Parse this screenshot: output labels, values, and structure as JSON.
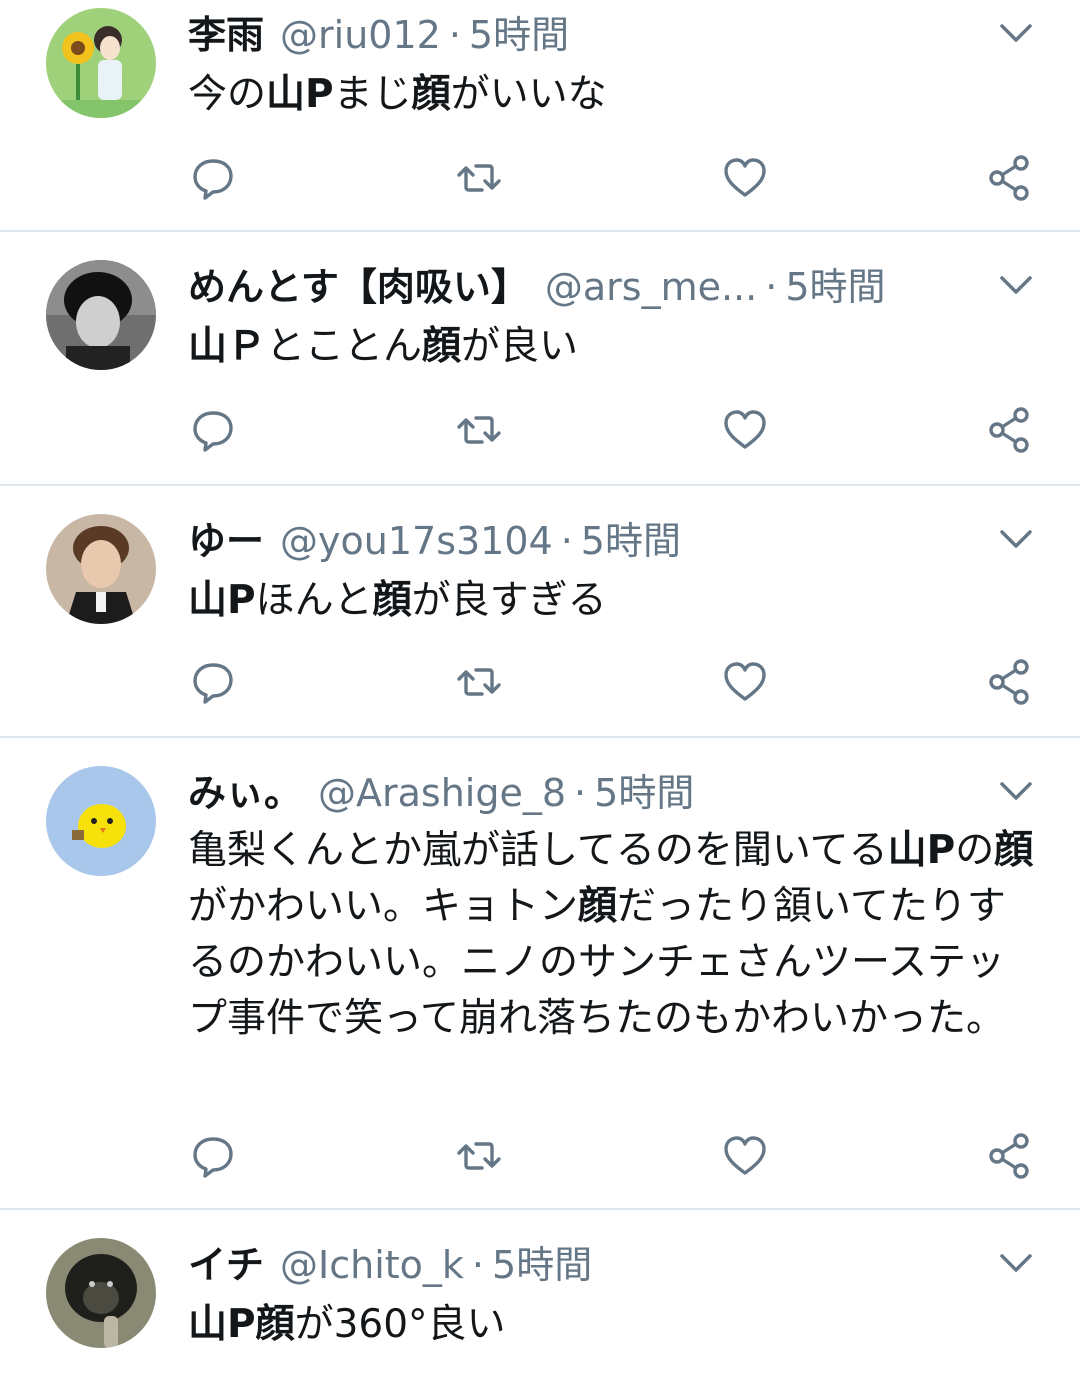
{
  "colors": {
    "text": "#14171a",
    "muted": "#657786",
    "divider": "#e1e8ed",
    "background": "#ffffff"
  },
  "action_icons": [
    "reply-icon",
    "retweet-icon",
    "like-icon",
    "share-icon"
  ],
  "tweets": [
    {
      "name": "李雨",
      "handle": "@riu012",
      "separator": "·",
      "time": "5時間",
      "text_parts": [
        {
          "t": "今の",
          "b": false
        },
        {
          "t": "山P",
          "b": true
        },
        {
          "t": "まじ",
          "b": false
        },
        {
          "t": "顔",
          "b": true
        },
        {
          "t": "がいいな",
          "b": false
        }
      ],
      "avatar": "avatar-sunflower-girl"
    },
    {
      "name": "めんとす【肉吸い】",
      "handle": "@ars_me...",
      "separator": "·",
      "time": "5時間",
      "text_parts": [
        {
          "t": "山Ｐ",
          "b": true
        },
        {
          "t": "とことん",
          "b": false
        },
        {
          "t": "顔",
          "b": true
        },
        {
          "t": "が良い",
          "b": false
        }
      ],
      "avatar": "avatar-dark-portrait"
    },
    {
      "name": "ゆー",
      "handle": "@you17s3104",
      "separator": "·",
      "time": "5時間",
      "text_parts": [
        {
          "t": "山P",
          "b": true
        },
        {
          "t": "ほんと",
          "b": false
        },
        {
          "t": "顔",
          "b": true
        },
        {
          "t": "が良すぎる",
          "b": false
        }
      ],
      "avatar": "avatar-man-suit"
    },
    {
      "name": "みぃ。",
      "handle": "@Arashige_8",
      "separator": "·",
      "time": "5時間",
      "text_parts": [
        {
          "t": "亀梨くんとか嵐が話してるのを聞いてる",
          "b": false
        },
        {
          "t": "山P",
          "b": true
        },
        {
          "t": "の",
          "b": false
        },
        {
          "t": "顔",
          "b": true
        },
        {
          "t": "がかわいい。キョトン",
          "b": false
        },
        {
          "t": "顔",
          "b": true
        },
        {
          "t": "だったり頷いてたりするのかわいい。ニノのサンチェさんツーステップ事件で笑って崩れ落ちたのもかわいかった。",
          "b": false
        }
      ],
      "avatar": "avatar-yellow-chick"
    },
    {
      "name": "イチ",
      "handle": "@Ichito_k",
      "separator": "·",
      "time": "5時間",
      "text_parts": [
        {
          "t": "山P顔",
          "b": true
        },
        {
          "t": "が360°良い",
          "b": false
        }
      ],
      "avatar": "avatar-gorilla"
    }
  ]
}
